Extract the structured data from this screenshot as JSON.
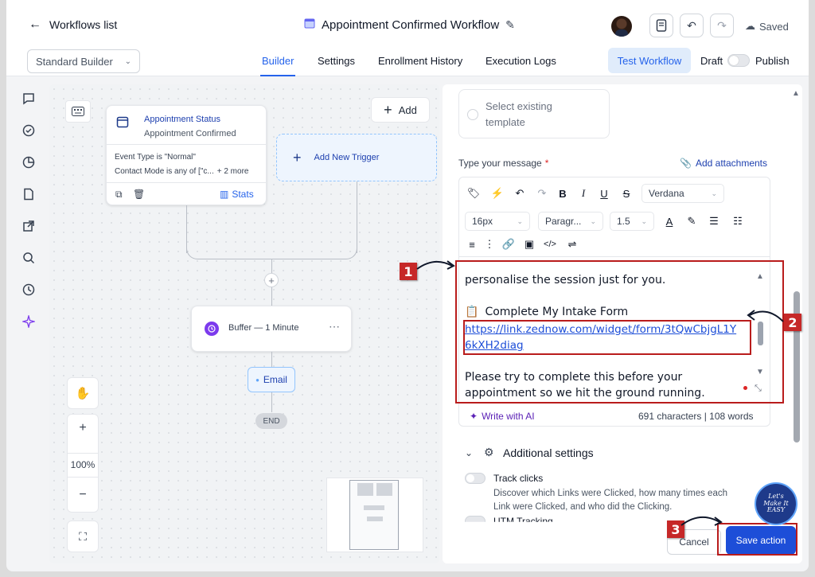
{
  "header": {
    "back_label": "Workflows list",
    "workflow_title": "Appointment Confirmed Workflow",
    "saved_label": "Saved"
  },
  "subbar": {
    "builder_select": "Standard Builder",
    "tabs": [
      {
        "label": "Builder"
      },
      {
        "label": "Settings"
      },
      {
        "label": "Enrollment History"
      },
      {
        "label": "Execution Logs"
      }
    ],
    "test_label": "Test Workflow",
    "draft_label": "Draft",
    "publish_label": "Publish"
  },
  "canvas": {
    "add_label": "Add",
    "trigger": {
      "title": "Appointment Status",
      "subtitle": "Appointment Confirmed",
      "filter1": "Event Type is \"Normal\"",
      "filter2": "Contact Mode is any of [\"c...",
      "more": "+ 2 more",
      "stats_label": "Stats"
    },
    "add_trigger_label": "Add New Trigger",
    "buffer_label": "Buffer — 1 Minute",
    "email_label": "Email",
    "end_label": "END",
    "zoom_level": "100%"
  },
  "panel": {
    "template_placeholder_1": "Select existing",
    "template_placeholder_2": "template",
    "message_label": "Type your message",
    "required_mark": "*",
    "attachments_label": "Add attachments",
    "font_family": "Verdana",
    "font_size": "16px",
    "paragraph": "Paragr...",
    "line_height": "1.5",
    "message_lines": {
      "line1": "personalise the session just for you.",
      "line2": "Complete My Intake Form",
      "link1": "https://link.zednow.com/widget/form/3tQwCbjgL1Y",
      "link2": "6kXH2diag",
      "line3": "Please try to complete this before your",
      "line4": "appointment so we hit the ground running."
    },
    "write_ai_label": "Write with AI",
    "char_count": "691 characters | 108 words",
    "additional_settings": "Additional settings",
    "track_clicks_label": "Track clicks",
    "track_clicks_desc1": "Discover which Links were Clicked, how many times each",
    "track_clicks_desc2": "Link were Clicked, and who did the Clicking.",
    "utm_label": "UTM Tracking",
    "cancel_label": "Cancel",
    "save_label": "Save action"
  },
  "annotations": {
    "badge1": "1",
    "badge2": "2",
    "badge3": "3",
    "watermark": "Let's Make It EASY"
  },
  "colors": {
    "accent": "#2563eb",
    "annotation_red": "#b91c1c",
    "save_button": "#1d4ed8"
  }
}
